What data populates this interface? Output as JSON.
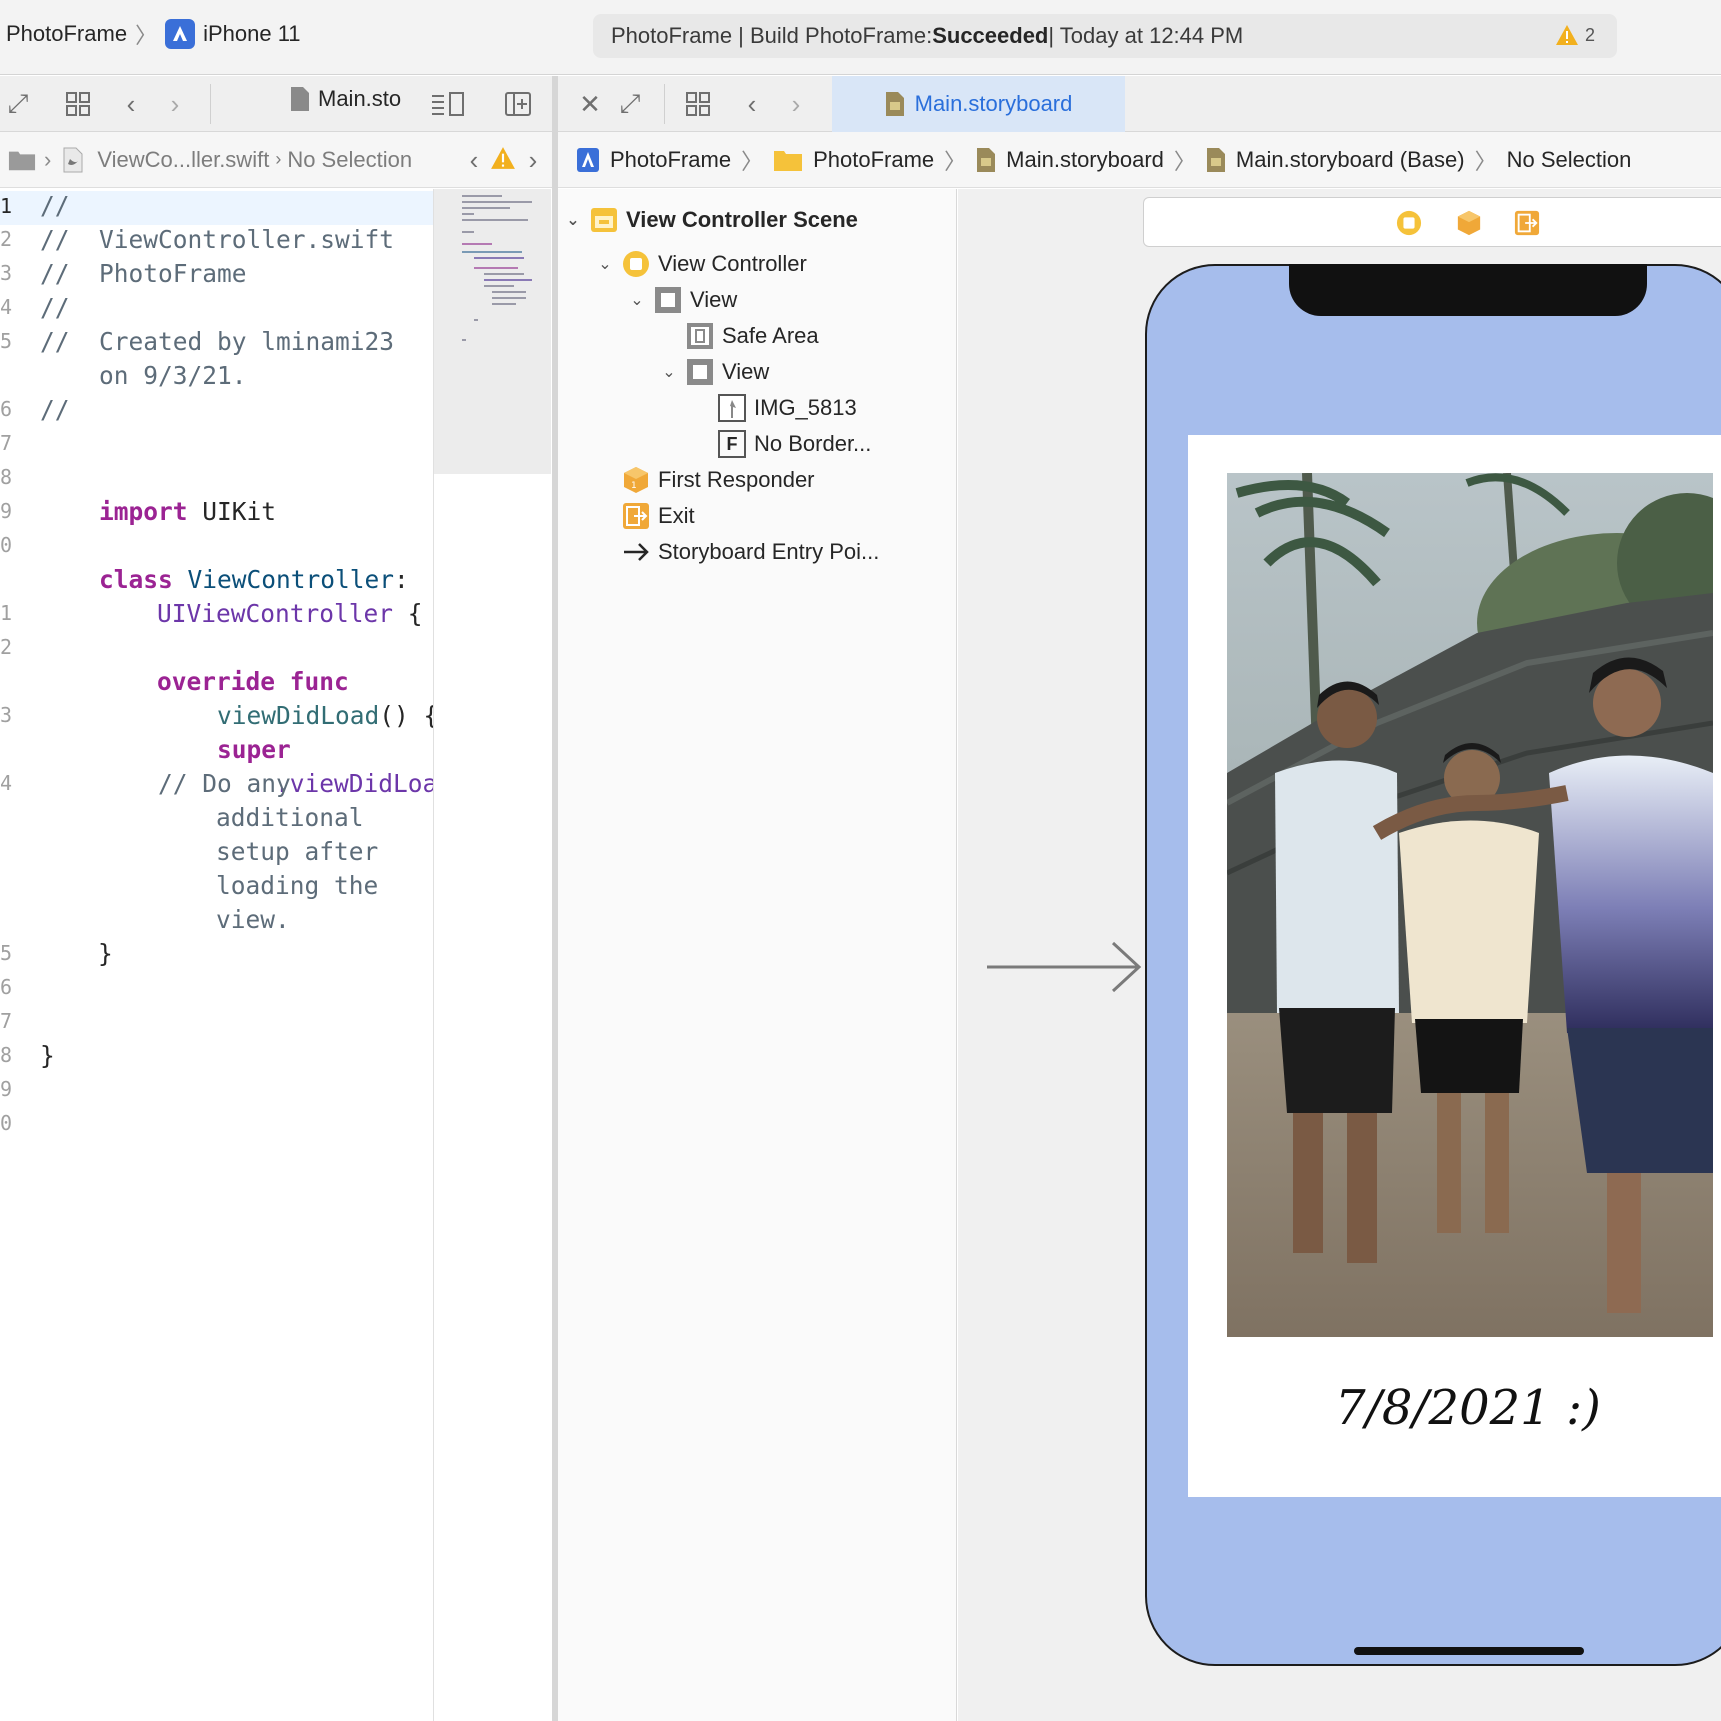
{
  "toolbar": {
    "scheme_project": "PhotoFrame",
    "scheme_device": "iPhone 11",
    "activity_prefix": "PhotoFrame | Build PhotoFrame: ",
    "activity_status": "Succeeded",
    "activity_suffix": " | Today at 12:44 PM",
    "warning_count": "2"
  },
  "left_editor": {
    "tab_title": "Main.sto",
    "jump_file": "ViewCo...ller.swift",
    "jump_selection": "No Selection",
    "line_numbers": [
      "1",
      "2",
      "3",
      "4",
      "5",
      "",
      "6",
      "7",
      "8",
      "9",
      "0",
      "",
      "1",
      "2",
      "",
      "3",
      "",
      "4",
      "",
      "",
      "",
      "",
      "5",
      "6",
      "7",
      "8",
      "9",
      "0"
    ],
    "code": {
      "l1": "//",
      "l2": "//  ViewController.swift",
      "l3": "//  PhotoFrame",
      "l4": "//",
      "l5a": "//  Created by lminami23",
      "l5b": "    on 9/3/21.",
      "l6": "//",
      "import_kw": "import",
      "import_mod": " UIKit",
      "class_kw": "class",
      "class_name": " ViewController",
      "class_colon": ":",
      "super_type": "UIViewController",
      "brace_open": " {",
      "override_kw": "override",
      "func_kw": " func",
      "fn_name": "viewDidLoad",
      "fn_rest": "() {",
      "super_kw": "super",
      "super_call": ".viewDidLoad",
      "super_parens": "()",
      "cmt1": "// Do any",
      "cmt2": "additional",
      "cmt3": "setup after",
      "cmt4": "loading the",
      "cmt5": "view.",
      "close_inner": "}",
      "close_outer": "}"
    }
  },
  "right_editor": {
    "tab_title": "Main.storyboard",
    "jump_bar": [
      "PhotoFrame",
      "PhotoFrame",
      "Main.storyboard",
      "Main.storyboard (Base)",
      "No Selection"
    ]
  },
  "outline": {
    "scene": "View Controller Scene",
    "view_controller": "View Controller",
    "view": "View",
    "safe_area": "Safe Area",
    "inner_view": "View",
    "image": "IMG_5813",
    "label": "No Border...",
    "first_responder": "First Responder",
    "exit": "Exit",
    "entry_point": "Storyboard Entry Poi..."
  },
  "canvas": {
    "date_text": "7/8/2021 :)",
    "phone_bg_color": "#a6bdec"
  },
  "icons": {
    "warning": "warning-icon",
    "swift_file": "swift-file-icon",
    "storyboard": "storyboard-file-icon",
    "folder": "folder-icon",
    "app": "app-icon"
  }
}
